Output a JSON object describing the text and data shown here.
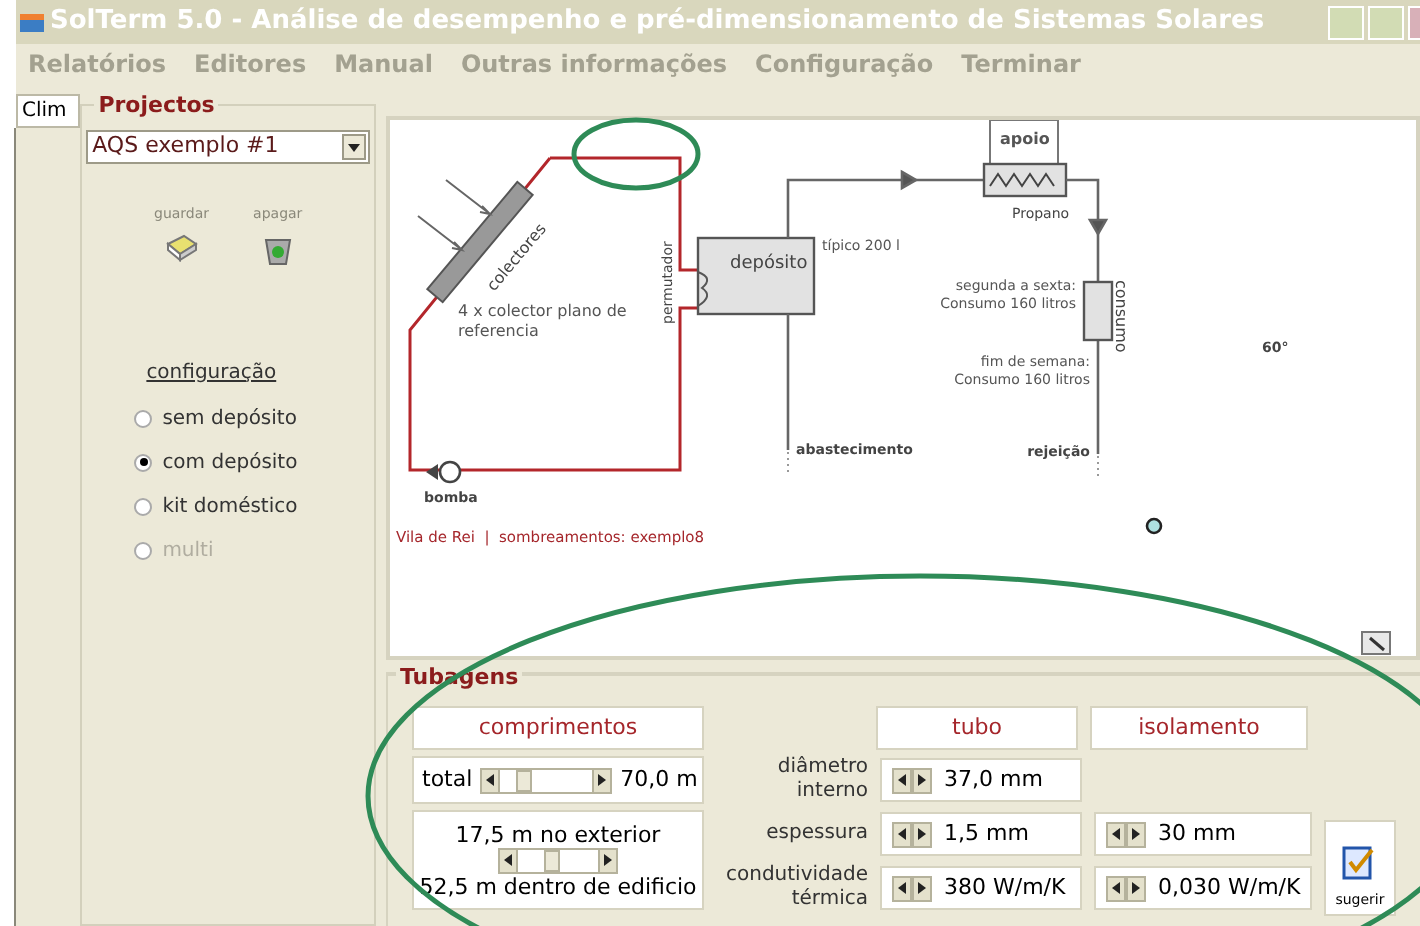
{
  "window": {
    "title": "SolTerm 5.0 - Análise de desempenho e pré-dimensionamento de Sistemas Solares"
  },
  "menu": [
    {
      "label": "Relatórios"
    },
    {
      "label": "Editores"
    },
    {
      "label": "Manual"
    },
    {
      "label": "Outras informações"
    },
    {
      "label": "Configuração"
    },
    {
      "label": "Terminar"
    }
  ],
  "side_tab": {
    "label": "Clim",
    "selected": true
  },
  "projects": {
    "title": "Projectos",
    "project": "AQS exemplo #1",
    "actions": [
      {
        "kind": "save",
        "label": "guardar"
      },
      {
        "kind": "delete",
        "label": "apagar"
      }
    ],
    "configuration_title": "configuração",
    "options": [
      {
        "label": "sem depósito",
        "selected": false,
        "disabled": false
      },
      {
        "label": "com depósito",
        "selected": true,
        "disabled": false
      },
      {
        "label": "kit doméstico",
        "selected": false,
        "disabled": false
      },
      {
        "label": "multi",
        "selected": false,
        "disabled": true
      }
    ]
  },
  "diagram": {
    "collectors": "colectores",
    "collector_note": [
      "4 x colector plano de",
      "referencia"
    ],
    "pump": "bomba",
    "exchanger": "permutador",
    "tank": "depósito",
    "tank_note": "típico 200 l",
    "supply": "abastecimento",
    "backup": "apoio",
    "fuel": "Propano",
    "consumption": "consumo",
    "weekday": [
      "segunda a sexta:",
      "Consumo 160 litros"
    ],
    "weekend": [
      "fim de semana:",
      "Consumo 160 litros"
    ],
    "rejection": "rejeição",
    "angle": "60°",
    "footer": "Vila de Rei  |  sombreamentos: exemplo8"
  },
  "pipes": {
    "title": "Tubagens",
    "lengths_title": "comprimentos",
    "total": {
      "label": "total",
      "value": "70,0 m",
      "level": 0.2
    },
    "split": {
      "exterior": "17,5 m no exterior",
      "interior": "52,5 m dentro de edificio",
      "level": 0.4
    },
    "columns": [
      "tubo",
      "isolamento"
    ],
    "rows": [
      {
        "label": "diâmetro interno",
        "tube": "37,0 mm"
      },
      {
        "label": "espessura",
        "tube": "1,5 mm",
        "insulation": "30 mm"
      },
      {
        "label": "condutividade térmica",
        "tube": "380 W/m/K",
        "insulation": "0,030 W/m/K"
      }
    ],
    "suggest": "sugerir"
  }
}
